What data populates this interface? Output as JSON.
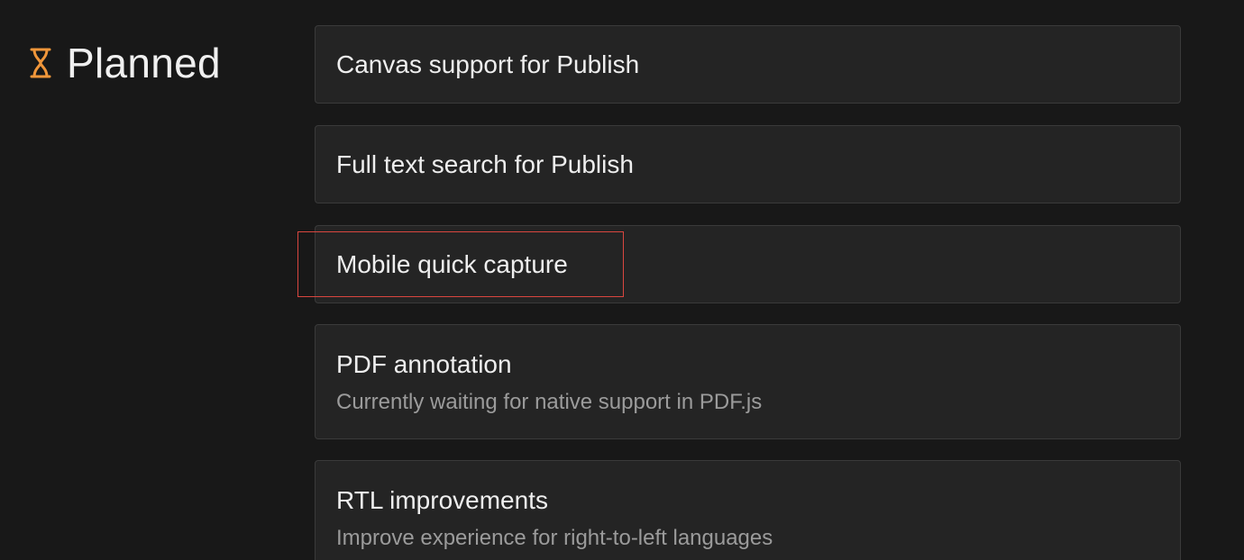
{
  "section": {
    "title": "Planned",
    "icon": "hourglass-icon",
    "icon_color": "#f0963a"
  },
  "items": [
    {
      "title": "Canvas support for Publish"
    },
    {
      "title": "Full text search for Publish"
    },
    {
      "title": "Mobile quick capture"
    },
    {
      "title": "PDF annotation",
      "description": "Currently waiting for native support in PDF.js"
    },
    {
      "title": "RTL improvements",
      "description": "Improve experience for right-to-left languages"
    }
  ],
  "highlight_color": "#d9463f"
}
